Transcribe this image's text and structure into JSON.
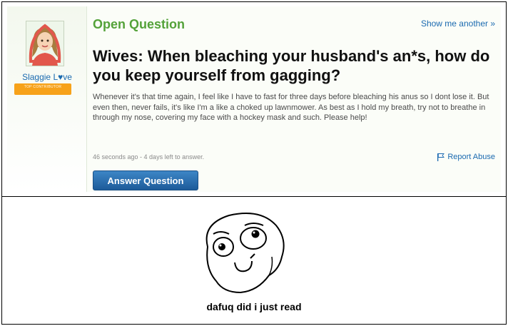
{
  "question_card": {
    "user": {
      "name": "Slaggie L♥ve",
      "badge": "TOP CONTRIBUTOR"
    },
    "status": "Open Question",
    "show_another": "Show me another »",
    "title": "Wives: When bleaching your husband's an*s, how do you keep yourself from gagging?",
    "body": "Whenever it's that time again, I feel like I have to fast for three days before bleaching his anus so I dont lose it. But even then, never fails, it's like I'm a like a choked up lawnmower. As best as I hold my breath, try not to breathe in through my nose, covering my face with a hockey mask and such. Please help!",
    "meta": "46 seconds ago - 4 days left to answer.",
    "report_abuse": "Report Abuse",
    "answer_button": "Answer Question",
    "colors": {
      "status_green": "#54a23a",
      "link_blue": "#1b6ab0",
      "button_blue": "#2b6faf",
      "badge_orange": "#f7a21a"
    }
  },
  "meme": {
    "caption": "dafuq did i just read",
    "face_icon": "rage-face-derp"
  }
}
